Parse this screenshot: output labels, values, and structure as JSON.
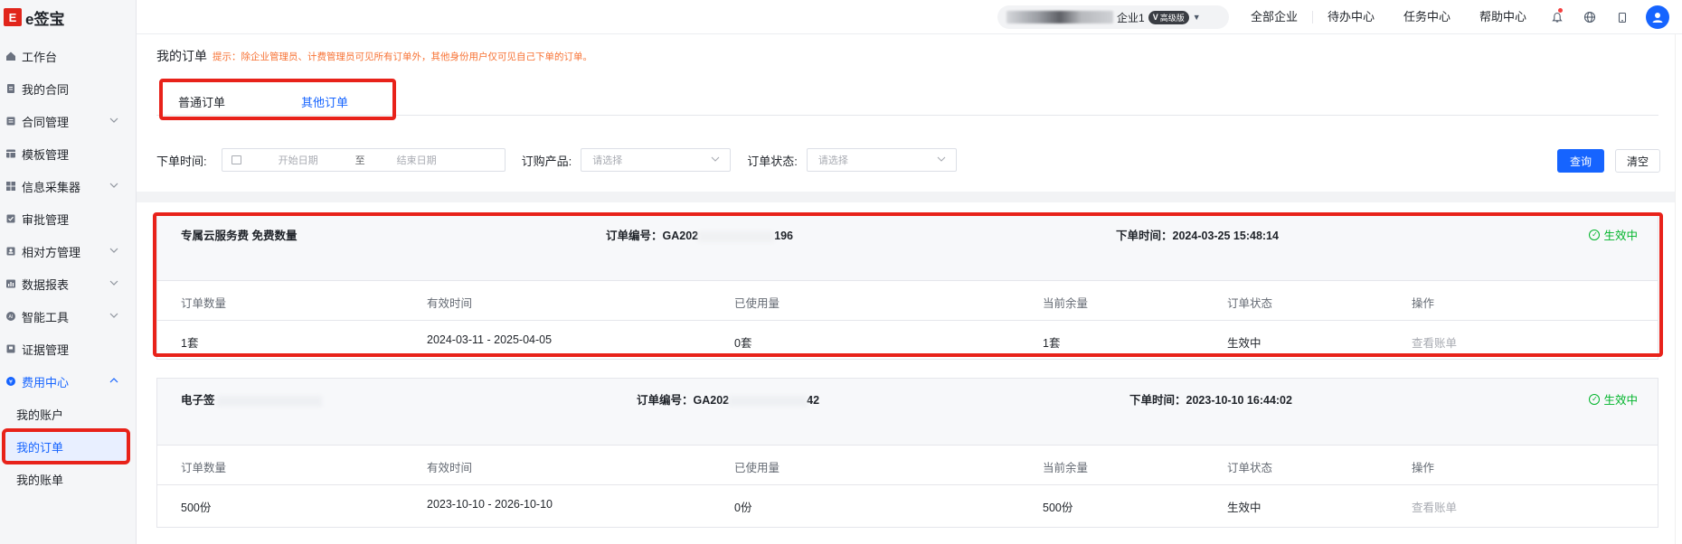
{
  "app": {
    "logo_mark": "E",
    "logo_text": "e签宝"
  },
  "sidebar": {
    "items": [
      {
        "label": "工作台",
        "icon": "home-icon"
      },
      {
        "label": "我的合同",
        "icon": "file-icon"
      },
      {
        "label": "合同管理",
        "icon": "folder-icon",
        "expandable": true
      },
      {
        "label": "模板管理",
        "icon": "template-icon"
      },
      {
        "label": "信息采集器",
        "icon": "grid-icon",
        "expandable": true
      },
      {
        "label": "审批管理",
        "icon": "approve-icon"
      },
      {
        "label": "相对方管理",
        "icon": "contacts-icon",
        "expandable": true
      },
      {
        "label": "数据报表",
        "icon": "report-icon",
        "expandable": true
      },
      {
        "label": "智能工具",
        "icon": "ai-icon",
        "expandable": true
      },
      {
        "label": "证据管理",
        "icon": "evidence-icon"
      },
      {
        "label": "费用中心",
        "icon": "money-icon",
        "expanded": true
      }
    ],
    "sub_items": [
      {
        "label": "我的账户"
      },
      {
        "label": "我的订单",
        "active": true
      },
      {
        "label": "我的账单"
      }
    ]
  },
  "topbar": {
    "company_suffix": "企业1",
    "plan_badge_mark": "V",
    "plan_badge": "高级版",
    "links": [
      "全部企业",
      "待办中心",
      "任务中心",
      "帮助中心"
    ],
    "icons": [
      "bell-icon",
      "globe-icon",
      "tablet-icon",
      "user-avatar-icon"
    ]
  },
  "page": {
    "title": "我的订单",
    "hint": "提示：除企业管理员、计费管理员可见所有订单外，其他身份用户仅可见自己下单的订单。",
    "tabs": [
      {
        "label": "普通订单"
      },
      {
        "label": "其他订单",
        "active": true
      }
    ]
  },
  "filters": {
    "order_time_label": "下单时间:",
    "start_placeholder": "开始日期",
    "range_sep": "至",
    "end_placeholder": "结束日期",
    "product_label": "订购产品:",
    "product_placeholder": "请选择",
    "status_label": "订单状态:",
    "status_placeholder": "请选择",
    "query_button": "查询",
    "clear_button": "清空"
  },
  "table_headers": [
    "订单数量",
    "有效时间",
    "已使用量",
    "当前余量",
    "订单状态",
    "操作"
  ],
  "orders": [
    {
      "product": "专属云服务费 免费数量",
      "order_no_label": "订单编号：",
      "order_no_prefix": "GA202",
      "order_no_suffix": "196",
      "order_time_label": "下单时间：",
      "order_time": "2024-03-25 15:48:14",
      "status": "生效中",
      "row": {
        "quantity": "1套",
        "validity": "2024-03-11 - 2025-04-05",
        "used": "0套",
        "remaining": "1套",
        "status": "生效中",
        "action": "查看账单"
      }
    },
    {
      "product": "电子签",
      "order_no_label": "订单编号：",
      "order_no_prefix": "GA202",
      "order_no_suffix": "42",
      "order_time_label": "下单时间：",
      "order_time": "2023-10-10 16:44:02",
      "status": "生效中",
      "row": {
        "quantity": "500份",
        "validity": "2023-10-10 - 2026-10-10",
        "used": "0份",
        "remaining": "500份",
        "status": "生效中",
        "action": "查看账单"
      }
    }
  ]
}
